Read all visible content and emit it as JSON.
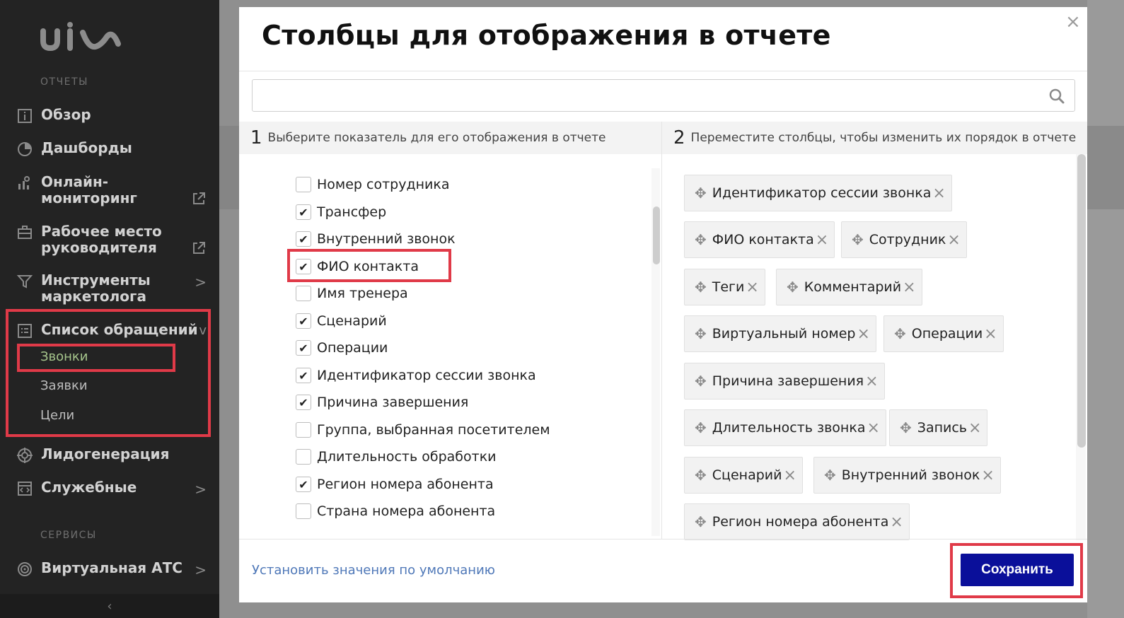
{
  "sidebar": {
    "logo": "uis",
    "section_reports": "ОТЧЕТЫ",
    "items": [
      {
        "label": "Обзор",
        "icon": "info-icon"
      },
      {
        "label": "Дашборды",
        "icon": "pie-chart-icon"
      },
      {
        "label": "Онлайн-\nмониторинг",
        "icon": "monitoring-icon",
        "aux": "external-link-icon"
      },
      {
        "label": "Рабочее место\nруководителя",
        "icon": "briefcase-icon",
        "aux": "external-link-icon"
      },
      {
        "label": "Инструменты\nмаркетолога",
        "icon": "filter-icon",
        "aux": "chevron-right-icon"
      },
      {
        "label": "Список обращений",
        "icon": "list-icon",
        "aux": "chevron-down-icon"
      },
      {
        "label": "Лидогенерация",
        "icon": "target-icon"
      },
      {
        "label": "Служебные",
        "icon": "code-icon",
        "aux": "chevron-right-icon"
      },
      {
        "label": "Виртуальная АТС",
        "icon": "pbx-icon",
        "aux": "chevron-right-icon"
      }
    ],
    "sub_items": [
      "Звонки",
      "Заявки",
      "Цели"
    ],
    "section_services": "СЕРВИСЫ",
    "collapse": "‹"
  },
  "modal": {
    "title": "Столбцы для отображения в отчете",
    "close": "×",
    "search_placeholder": "",
    "left_header_num": "1",
    "left_header_text": "Выберите показатель для его отображения в отчете",
    "right_header_num": "2",
    "right_header_text": "Переместите столбцы, чтобы изменить их порядок в отчете",
    "checkboxes": [
      {
        "label": "Номер сотрудника",
        "checked": false
      },
      {
        "label": "Трансфер",
        "checked": true
      },
      {
        "label": "Внутренний звонок",
        "checked": true
      },
      {
        "label": "ФИО контакта",
        "checked": true
      },
      {
        "label": "Имя тренера",
        "checked": false
      },
      {
        "label": "Сценарий",
        "checked": true
      },
      {
        "label": "Операции",
        "checked": true
      },
      {
        "label": "Идентификатор сессии звонка",
        "checked": true
      },
      {
        "label": "Причина завершения",
        "checked": true
      },
      {
        "label": "Группа, выбранная посетителем",
        "checked": false
      },
      {
        "label": "Длительность обработки",
        "checked": false
      },
      {
        "label": "Регион номера абонента",
        "checked": true
      },
      {
        "label": "Страна номера абонента",
        "checked": false
      }
    ],
    "chips": [
      "Идентификатор сессии звонка",
      "ФИО контакта",
      "Сотрудник",
      "Теги",
      "Комментарий",
      "Виртуальный номер",
      "Операции",
      "Причина завершения",
      "Длительность звонка",
      "Запись",
      "Сценарий",
      "Внутренний звонок",
      "Регион номера абонента"
    ],
    "default_link": "Установить значения по умолчанию",
    "save_label": "Сохранить"
  },
  "colors": {
    "sidebar_bg": "#232323",
    "highlight": "#e03a48",
    "save_btn": "#0a0f9a",
    "active_sub": "#a6c58c",
    "link": "#4f78b8"
  }
}
